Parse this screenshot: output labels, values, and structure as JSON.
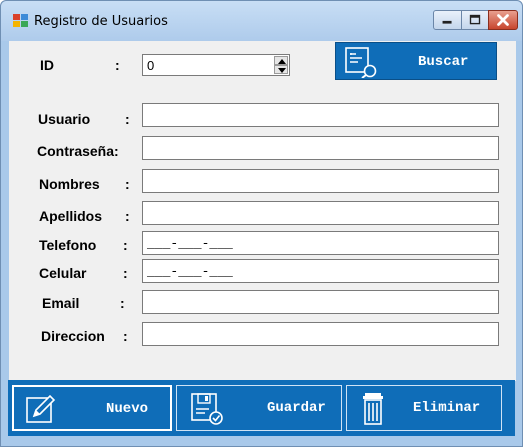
{
  "window": {
    "title": "Registro de Usuarios",
    "controls": {
      "minimize": "minimize",
      "maximize": "maximize",
      "close": "close"
    }
  },
  "id_row": {
    "label": "ID",
    "colon": ":",
    "value": "0"
  },
  "search_button": {
    "label": "Buscar",
    "icon": "document-search-icon"
  },
  "fields": [
    {
      "label": "Usuario",
      "colon": ":",
      "value": ""
    },
    {
      "label": "Contraseña:",
      "colon": "",
      "value": ""
    },
    {
      "label": "Nombres",
      "colon": ":",
      "value": ""
    },
    {
      "label": "Apellidos",
      "colon": ":",
      "value": ""
    },
    {
      "label": "Telefono",
      "colon": ":",
      "value": "___-___-___"
    },
    {
      "label": "Celular",
      "colon": ":",
      "value": "___-___-___"
    },
    {
      "label": "Email",
      "colon": ":",
      "value": ""
    },
    {
      "label": "Direccion",
      "colon": ":",
      "value": ""
    }
  ],
  "actions": {
    "nuevo": {
      "label": "Nuevo",
      "icon": "edit-icon"
    },
    "guardar": {
      "label": "Guardar",
      "icon": "save-icon"
    },
    "eliminar": {
      "label": "Eliminar",
      "icon": "trash-icon"
    }
  },
  "colors": {
    "accent": "#0f6db8",
    "client_bg": "#f0f0f0",
    "frame": "#a9c9ea"
  }
}
